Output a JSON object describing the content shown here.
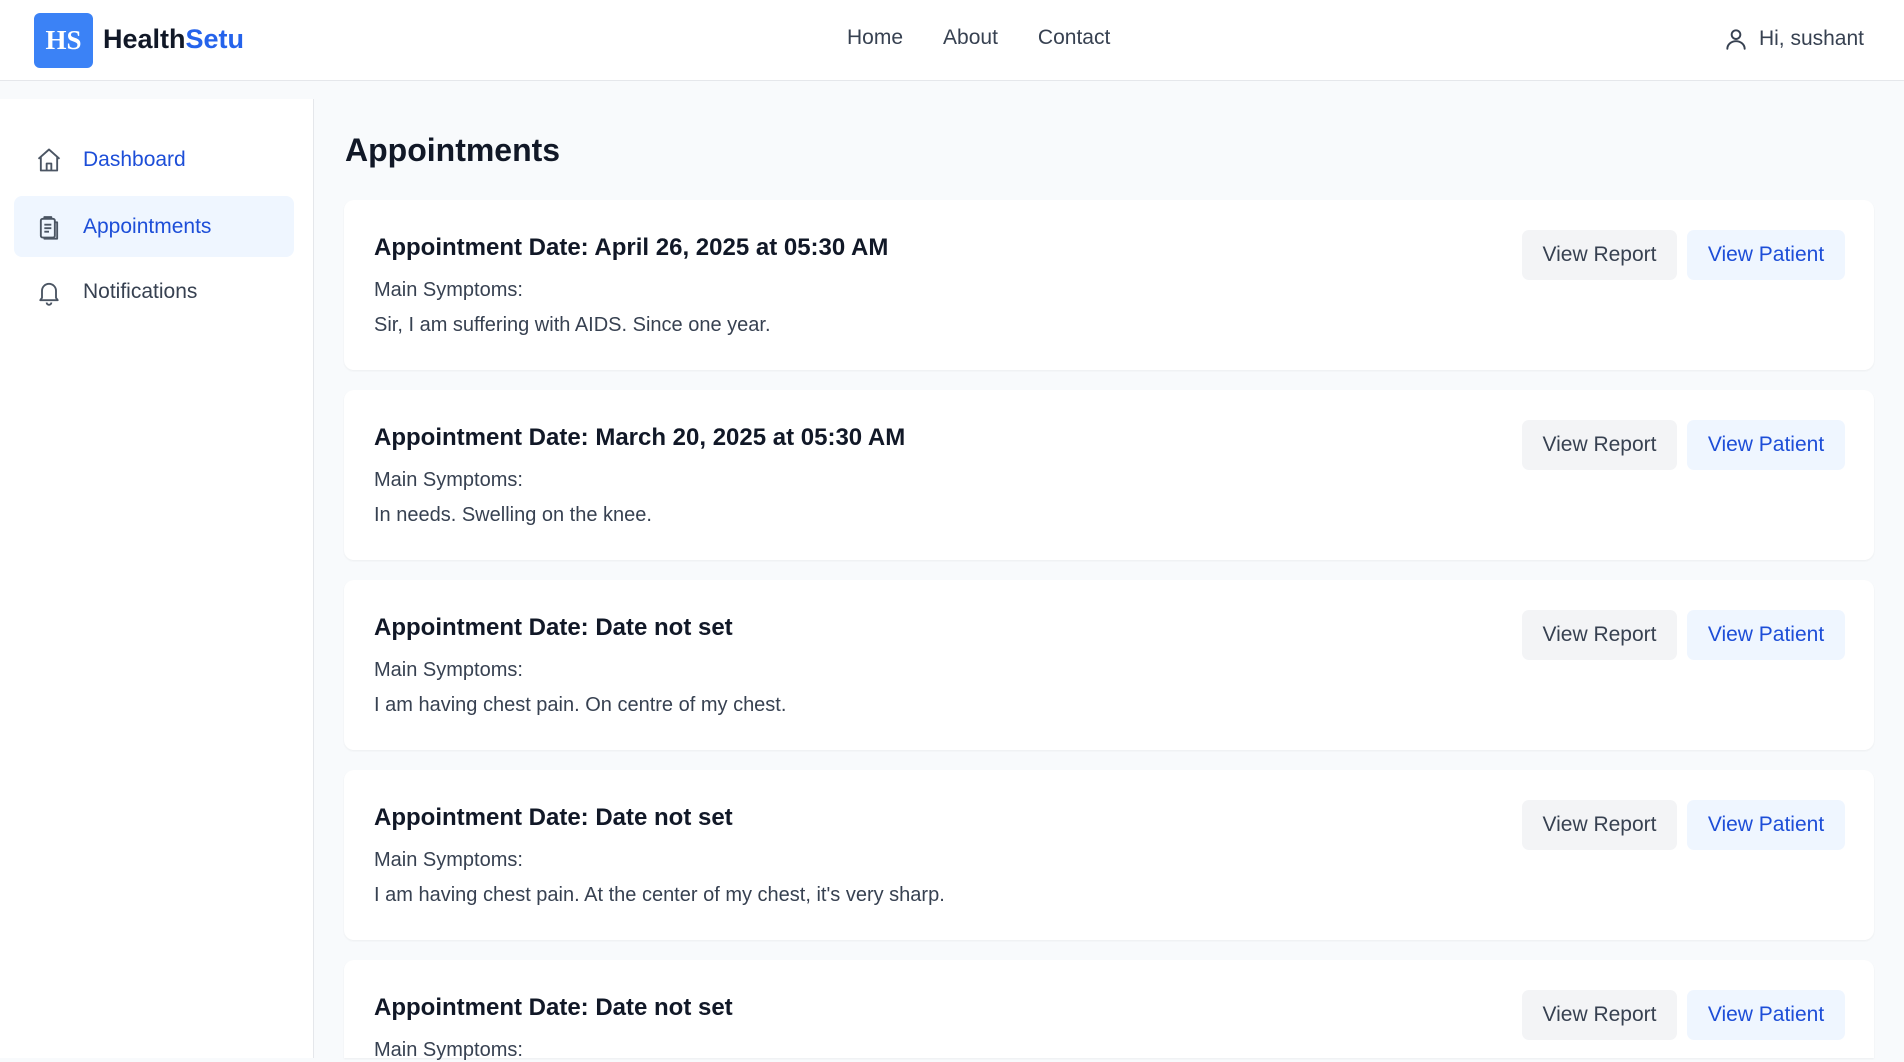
{
  "header": {
    "logo_text": "HS",
    "brand_main": "Health",
    "brand_accent": "Setu",
    "nav": [
      "Home",
      "About",
      "Contact"
    ],
    "greeting": "Hi, sushant",
    "user_icon": "user-icon"
  },
  "sidebar": {
    "items": [
      {
        "label": "Dashboard",
        "icon": "home-icon"
      },
      {
        "label": "Appointments",
        "icon": "clipboard-icon"
      },
      {
        "label": "Notifications",
        "icon": "bell-icon"
      }
    ]
  },
  "main": {
    "title": "Appointments",
    "symptoms_label": "Main Symptoms:",
    "view_report_label": "View Report",
    "view_patient_label": "View Patient",
    "appointments": [
      {
        "date": "Appointment Date: April 26, 2025 at 05:30 AM",
        "symptoms": "Sir, I am suffering with AIDS. Since one year."
      },
      {
        "date": "Appointment Date: March 20, 2025 at 05:30 AM",
        "symptoms": "In needs. Swelling on the knee."
      },
      {
        "date": "Appointment Date: Date not set",
        "symptoms": "I am having chest pain. On centre of my chest."
      },
      {
        "date": "Appointment Date: Date not set",
        "symptoms": "I am having chest pain. At the center of my chest, it's very sharp."
      },
      {
        "date": "Appointment Date: Date not set",
        "symptoms": ""
      }
    ]
  },
  "colors": {
    "accent": "#2563eb",
    "logo_bg": "#3b82f6",
    "active_bg": "#eff6ff"
  }
}
